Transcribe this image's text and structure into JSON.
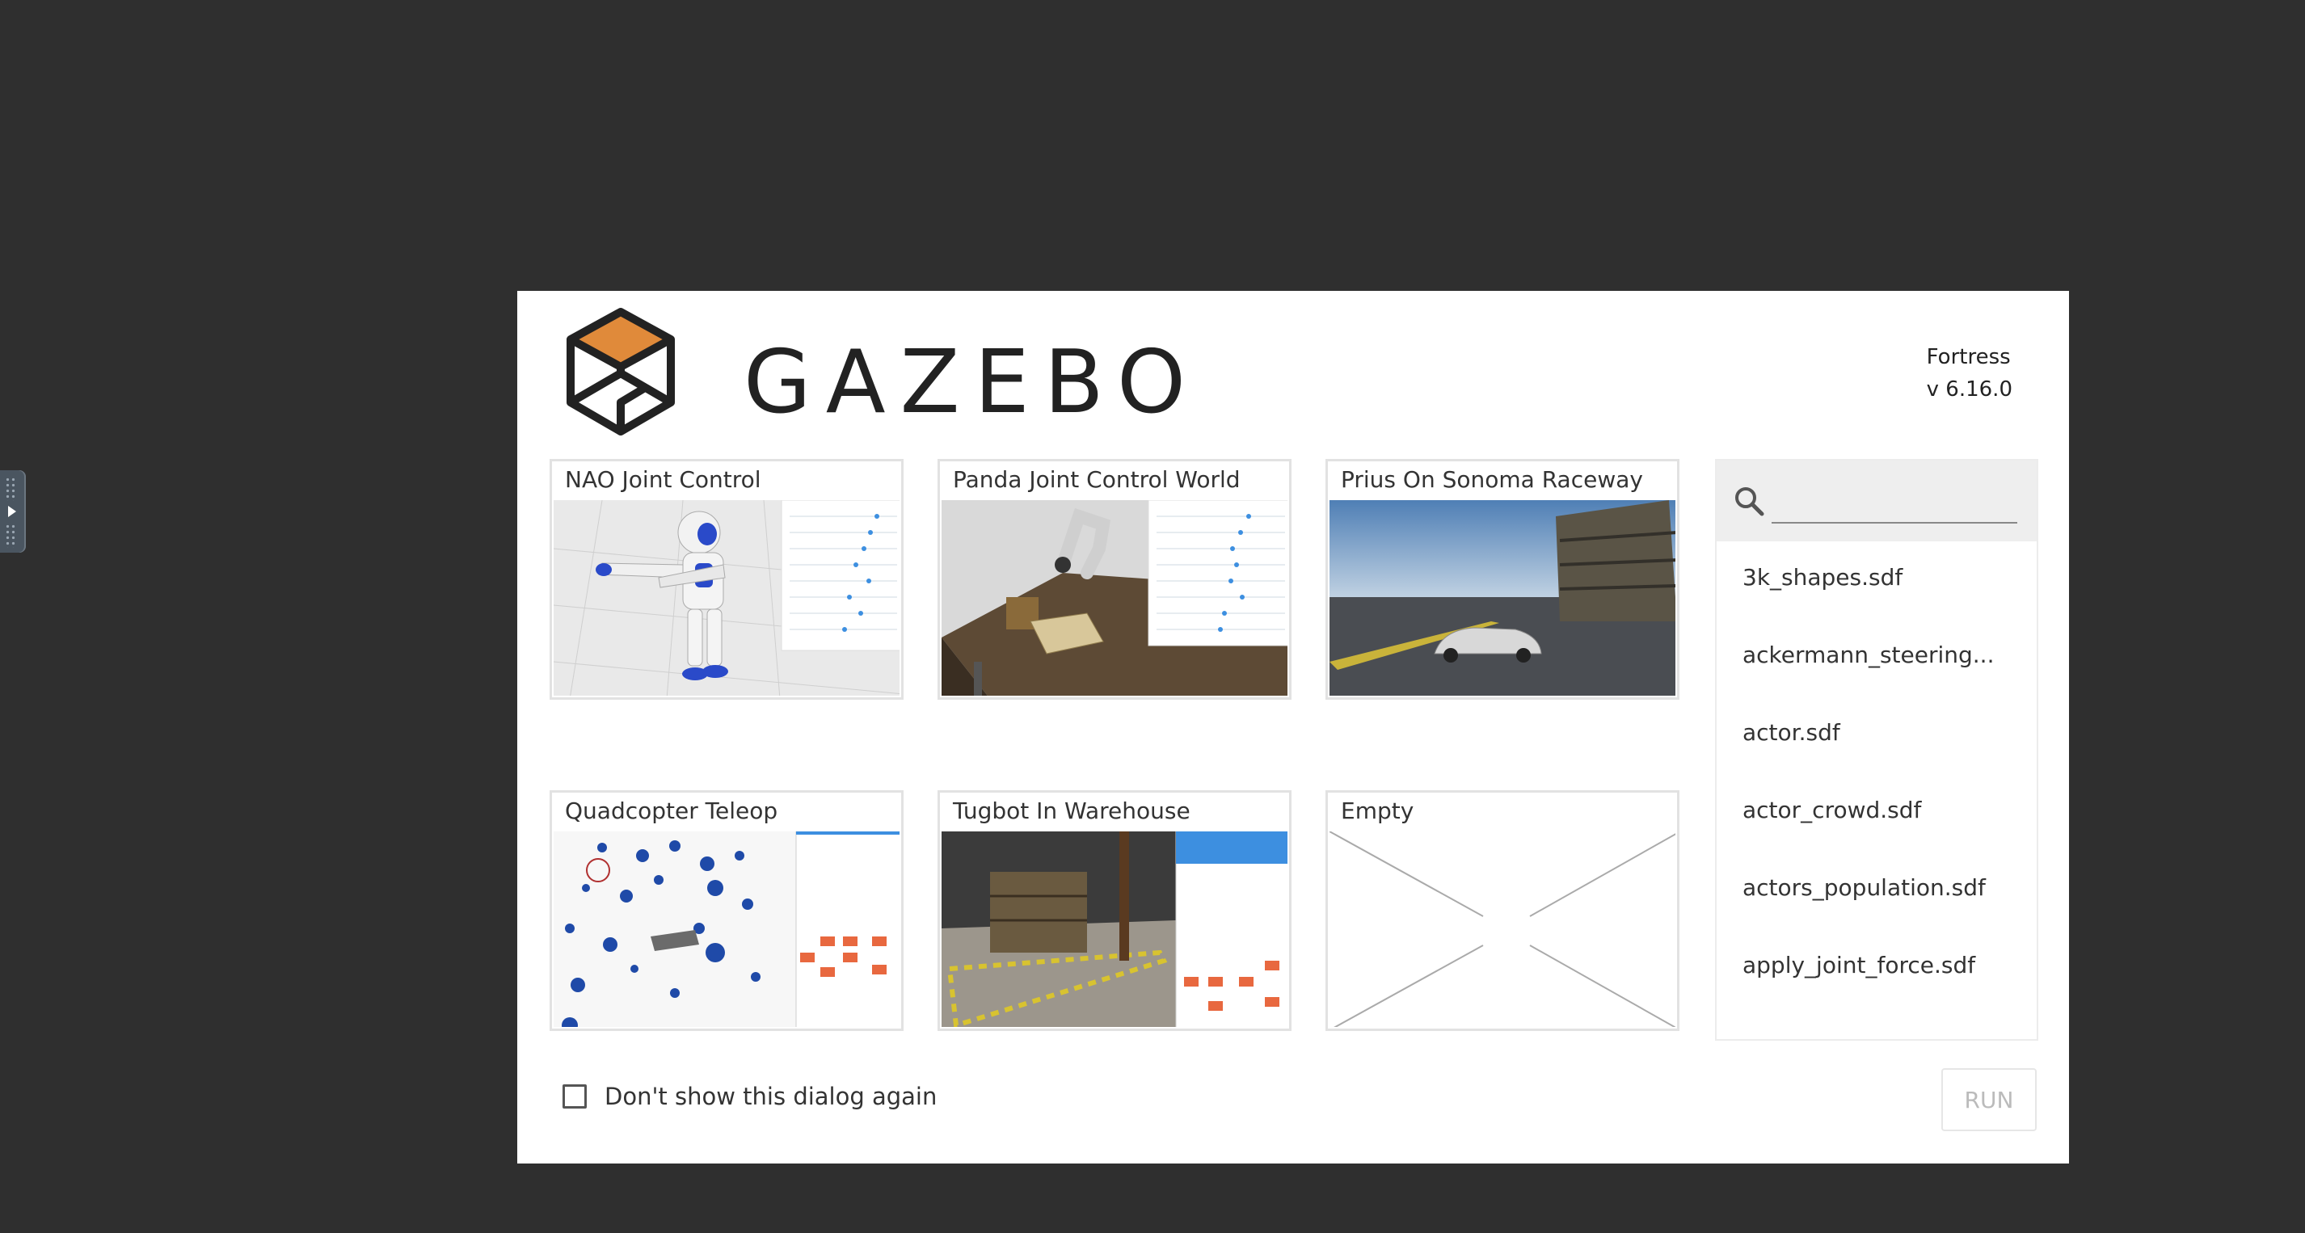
{
  "dialog": {
    "logo_text": "GAZEBO",
    "release_name": "Fortress",
    "version": "v 6.16.0"
  },
  "worlds": [
    {
      "title": "NAO Joint Control",
      "thumbnail": "nao-robot-preview"
    },
    {
      "title": "Panda Joint Control World",
      "thumbnail": "panda-arm-preview"
    },
    {
      "title": "Prius On Sonoma Raceway",
      "thumbnail": "prius-raceway-preview"
    },
    {
      "title": "Quadcopter Teleop",
      "thumbnail": "quadcopter-preview"
    },
    {
      "title": "Tugbot In Warehouse",
      "thumbnail": "tugbot-warehouse-preview"
    },
    {
      "title": "Empty",
      "thumbnail": "empty-placeholder"
    }
  ],
  "search": {
    "placeholder": "",
    "value": "",
    "icon": "search-icon"
  },
  "sdf_files": [
    "3k_shapes.sdf",
    "ackermann_steering...",
    "actor.sdf",
    "actor_crowd.sdf",
    "actors_population.sdf",
    "apply_joint_force.sdf"
  ],
  "footer": {
    "dont_show_label": "Don't show this dialog again",
    "dont_show_checked": false,
    "run_label": "RUN",
    "run_enabled": false
  },
  "colors": {
    "background": "#2f2f2f",
    "logo_orange": "#e08a3a",
    "dialog": "#ffffff"
  }
}
